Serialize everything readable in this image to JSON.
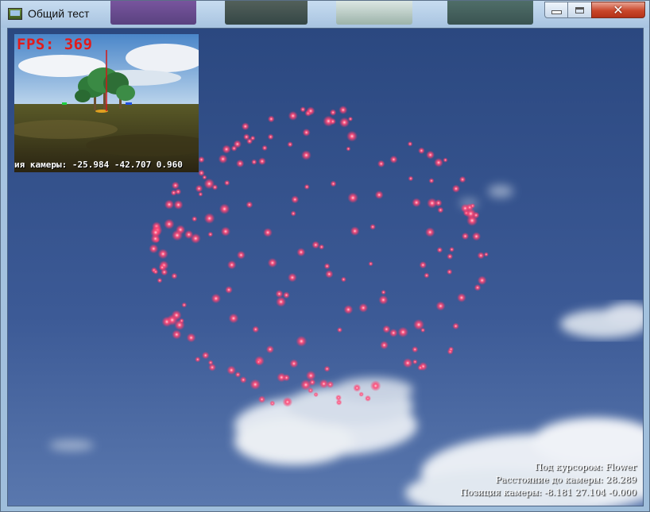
{
  "window": {
    "title": "Общий тест",
    "controls": {
      "close_glyph": "✕"
    }
  },
  "minimap": {
    "fps_label": "FPS: 369",
    "camera_direction": "ия камеры: -25.984 -42.707 0.960"
  },
  "hud": {
    "under_cursor": "Под курсором: Flower",
    "distance": "Расстояние до камеры: 28.289",
    "position": "Позиция камеры: -8.181 27.104 -0.000"
  },
  "colors": {
    "sky_top": "#2d4a80",
    "sky_bottom": "#5574ad",
    "particle": "#ff4d7a",
    "fps_text": "#e21b1b",
    "close_button": "#c9472b"
  },
  "icons": [
    "app-icon",
    "minimize-icon",
    "maximize-icon",
    "close-icon"
  ]
}
